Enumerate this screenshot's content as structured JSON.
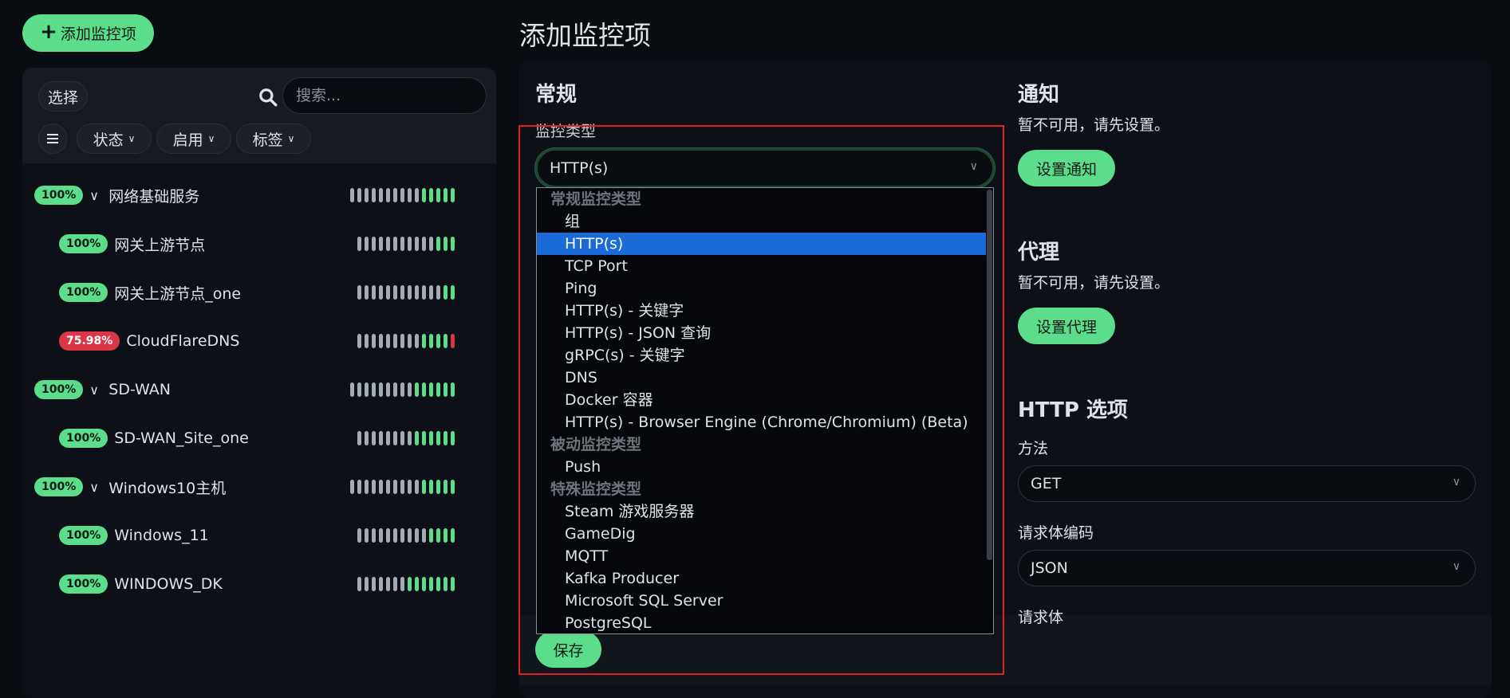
{
  "header": {
    "add_button_label": "添加监控项",
    "page_title": "添加监控项"
  },
  "list": {
    "select_label": "选择",
    "search_placeholder": "搜索...",
    "filters": {
      "status": "状态",
      "active": "启用",
      "tags": "标签"
    },
    "items": [
      {
        "uptime": "100%",
        "name": "网络基础服务",
        "group": true,
        "status": "up"
      },
      {
        "uptime": "100%",
        "name": "网关上游节点",
        "group": false,
        "status": "up"
      },
      {
        "uptime": "100%",
        "name": "网关上游节点_one",
        "group": false,
        "status": "up"
      },
      {
        "uptime": "75.98%",
        "name": "CloudFlareDNS",
        "group": false,
        "status": "down"
      },
      {
        "uptime": "100%",
        "name": "SD-WAN",
        "group": true,
        "status": "up"
      },
      {
        "uptime": "100%",
        "name": "SD-WAN_Site_one",
        "group": false,
        "status": "up"
      },
      {
        "uptime": "100%",
        "name": "Windows10主机",
        "group": true,
        "status": "up"
      },
      {
        "uptime": "100%",
        "name": "Windows_11",
        "group": false,
        "status": "up"
      },
      {
        "uptime": "100%",
        "name": "WINDOWS_DK",
        "group": false,
        "status": "up"
      }
    ]
  },
  "general": {
    "heading": "常规",
    "monitor_type_label": "监控类型",
    "monitor_type_value": "HTTP(s)",
    "dropdown_options": [
      {
        "label": "常规监控类型",
        "kind": "group"
      },
      {
        "label": "组",
        "kind": "option"
      },
      {
        "label": "HTTP(s)",
        "kind": "selected"
      },
      {
        "label": "TCP Port",
        "kind": "option"
      },
      {
        "label": "Ping",
        "kind": "option"
      },
      {
        "label": "HTTP(s) - 关键字",
        "kind": "option"
      },
      {
        "label": "HTTP(s) - JSON 查询",
        "kind": "option"
      },
      {
        "label": "gRPC(s) - 关键字",
        "kind": "option"
      },
      {
        "label": "DNS",
        "kind": "option"
      },
      {
        "label": "Docker 容器",
        "kind": "option"
      },
      {
        "label": "HTTP(s) - Browser Engine (Chrome/Chromium) (Beta)",
        "kind": "option"
      },
      {
        "label": "被动监控类型",
        "kind": "group"
      },
      {
        "label": "Push",
        "kind": "option"
      },
      {
        "label": "特殊监控类型",
        "kind": "group"
      },
      {
        "label": "Steam 游戏服务器",
        "kind": "option"
      },
      {
        "label": "GameDig",
        "kind": "option"
      },
      {
        "label": "MQTT",
        "kind": "option"
      },
      {
        "label": "Kafka Producer",
        "kind": "option"
      },
      {
        "label": "Microsoft SQL Server",
        "kind": "option"
      },
      {
        "label": "PostgreSQL",
        "kind": "option"
      }
    ]
  },
  "notification": {
    "heading": "通知",
    "unavailable_text": "暂不可用，请先设置。",
    "setup_button": "设置通知"
  },
  "proxy": {
    "heading": "代理",
    "unavailable_text": "暂不可用，请先设置。",
    "setup_button": "设置代理"
  },
  "http_options": {
    "heading": "HTTP 选项",
    "method_label": "方法",
    "method_value": "GET",
    "body_encoding_label": "请求体编码",
    "body_encoding_value": "JSON",
    "body_label": "请求体"
  },
  "footer": {
    "save_button": "保存"
  },
  "colors": {
    "accent": "#5cdd8b",
    "danger": "#dc3545",
    "selected_option": "#1a6bd8",
    "highlight_frame": "#e02020",
    "background": "#090c10",
    "panel": "#0d1117"
  },
  "icons": {
    "add": "plus-icon",
    "search": "search-icon",
    "list_toggle": "list-icon",
    "collapse": "chevron-down-icon",
    "select_arrow": "chevron-down-icon"
  }
}
